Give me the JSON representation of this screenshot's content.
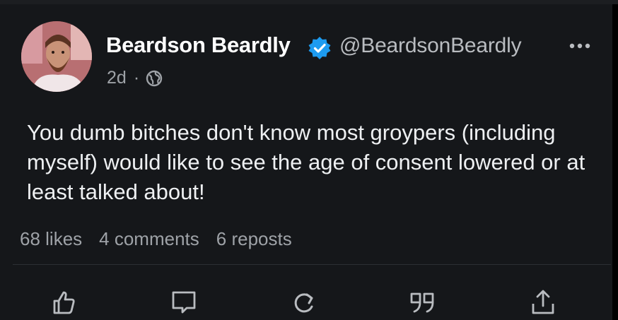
{
  "user": {
    "display_name": "Beardson Beardly",
    "handle": "@BeardsonBeardly",
    "verified": true,
    "timestamp": "2d",
    "separator": "·",
    "visibility_icon": "globe-icon"
  },
  "post": {
    "text": "You dumb bitches don't know most groypers (including myself) would like to see the age of consent lowered or at least talked about!"
  },
  "stats": {
    "likes": "68 likes",
    "comments": "4 comments",
    "reposts": "6 reposts"
  },
  "actions": [
    "like-icon",
    "comment-icon",
    "repost-icon",
    "quote-icon",
    "share-icon"
  ],
  "colors": {
    "background": "#15171a",
    "verified": "#1d9bf0",
    "secondary_text": "#9ea2a7"
  }
}
